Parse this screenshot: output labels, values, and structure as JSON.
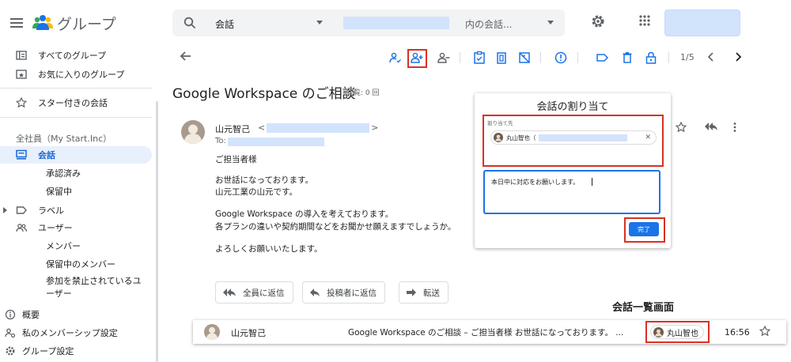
{
  "header": {
    "app_title": "グループ",
    "search": {
      "scope": "会話",
      "placeholder": "内の会話..."
    }
  },
  "sidebar": {
    "items": [
      {
        "label": "すべてのグループ",
        "icon": "all-groups-icon"
      },
      {
        "label": "お気に入りのグループ",
        "icon": "favorite-groups-icon"
      },
      {
        "label": "スター付きの会話",
        "icon": "star-icon"
      }
    ],
    "org_name": "全社員（My Start.Inc）",
    "group_nav": [
      {
        "label": "会話",
        "icon": "conversations-icon",
        "active": true
      },
      {
        "label": "承認済み"
      },
      {
        "label": "保留中"
      },
      {
        "label": "ラベル",
        "icon": "label-icon"
      },
      {
        "label": "ユーザー",
        "icon": "people-icon"
      },
      {
        "label": "メンバー"
      },
      {
        "label": "保留中のメンバー"
      },
      {
        "label": "参加を禁止されているユ"
      },
      {
        "label": "ーザー"
      },
      {
        "label": "概要",
        "icon": "info-icon"
      },
      {
        "label": "私のメンバーシップ設定",
        "icon": "membership-icon"
      },
      {
        "label": "グループ設定",
        "icon": "gear-icon"
      }
    ]
  },
  "toolbar": {
    "pagination": "1/5"
  },
  "conversation": {
    "title": "Google Workspace のご相談",
    "views": "閲覧: 0 回",
    "sender_name": "山元智己",
    "email_open": "<",
    "email_close": ">",
    "to_label": "To:",
    "body": [
      "ご担当者様",
      "お世話になっております。",
      "山元工業の山元です。",
      "Google Workspace の導入を考えております。",
      "各プランの違いや契約期間などをお聞かせ願えますでしょうか。",
      "よろしくお願いいたします。"
    ],
    "reply_all": "全員に返信",
    "reply_author": "投稿者に返信",
    "forward": "転送"
  },
  "assign_dialog": {
    "title": "会話の割り当て",
    "assignee_label": "割り当て先",
    "assignee_name": "丸山智也（",
    "note": "本日中に対応をお願いします。",
    "done": "完了"
  },
  "list_view": {
    "caption": "会話一覧画面",
    "sender": "山元智己",
    "snippet": "Google Workspace のご相談 – ご担当者様 お世話になっております。 ...",
    "assignee": "丸山智也",
    "time": "16:56"
  },
  "colors": {
    "accent": "#1a73e8",
    "highlight": "#d93025",
    "active_nav_bg": "#e8f0fe",
    "redaction": "#d2e3fc"
  }
}
